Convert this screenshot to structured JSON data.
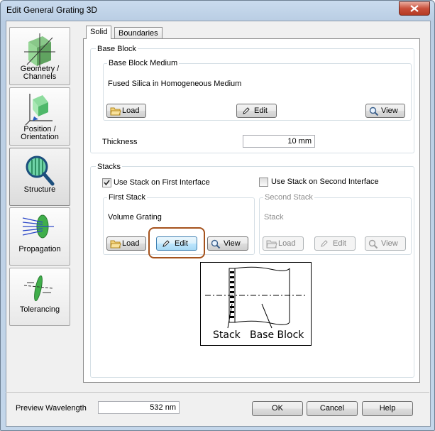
{
  "window": {
    "title": "Edit General Grating 3D"
  },
  "sidebar": [
    {
      "line1": "Geometry /",
      "line2": "Channels",
      "icon": "geometry-icon"
    },
    {
      "line1": "Position /",
      "line2": "Orientation",
      "icon": "position-icon"
    },
    {
      "line1": "Structure",
      "line2": "",
      "icon": "structure-icon"
    },
    {
      "line1": "Propagation",
      "line2": "",
      "icon": "propagation-icon"
    },
    {
      "line1": "Tolerancing",
      "line2": "",
      "icon": "tolerancing-icon"
    }
  ],
  "tabs": [
    "Solid",
    "Boundaries"
  ],
  "base_block": {
    "group_title": "Base Block",
    "medium_title": "Base Block Medium",
    "medium_value": "Fused Silica in Homogeneous Medium",
    "load": "Load",
    "edit": "Edit",
    "view": "View",
    "thickness_label": "Thickness",
    "thickness_value": "10 mm"
  },
  "stacks": {
    "group_title": "Stacks",
    "use_first": "Use Stack on First Interface",
    "use_second": "Use Stack on Second Interface",
    "first_title": "First Stack",
    "first_value": "Volume Grating",
    "second_title": "Second Stack",
    "second_value": "Stack",
    "load": "Load",
    "edit": "Edit",
    "view": "View"
  },
  "diagram": {
    "stack_label": "Stack",
    "base_label": "Base Block"
  },
  "footer": {
    "wavelength_label": "Preview Wavelength",
    "wavelength_value": "532 nm",
    "ok": "OK",
    "cancel": "Cancel",
    "help": "Help"
  }
}
